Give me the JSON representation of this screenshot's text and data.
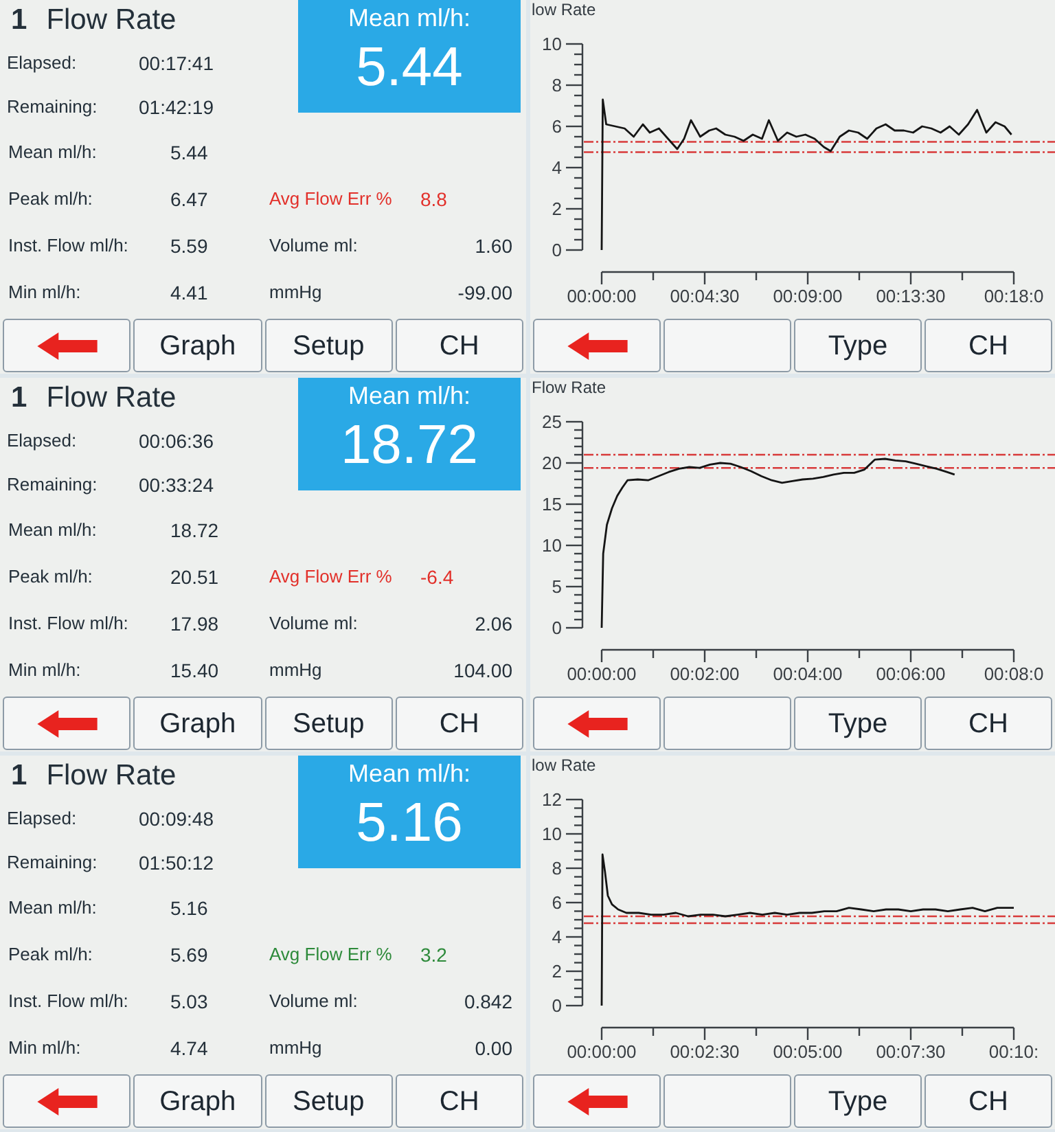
{
  "screens": [
    {
      "stats": {
        "channel": "1",
        "title": "Flow Rate",
        "mean_display": {
          "label": "Mean ml/h:",
          "value": "5.44"
        },
        "timers": [
          {
            "label": "Elapsed:",
            "value": "00:17:41"
          },
          {
            "label": "Remaining:",
            "value": "01:42:19"
          }
        ],
        "rates": [
          {
            "label": "Mean ml/h:",
            "value": "5.44"
          },
          {
            "label": "Peak ml/h:",
            "value": "6.47"
          },
          {
            "label": "Inst. Flow ml/h:",
            "value": "5.59"
          },
          {
            "label": "Min ml/h:",
            "value": "4.41"
          }
        ],
        "avg_flow_err": {
          "label": "Avg Flow Err %",
          "value": "8.8",
          "within_tolerance": false
        },
        "totals": [
          {
            "label": "Volume ml:",
            "value": "1.60"
          },
          {
            "label": "mmHg",
            "value": "-99.00"
          }
        ],
        "buttons": [
          {
            "kind": "back"
          },
          {
            "kind": "text",
            "label": "Graph"
          },
          {
            "kind": "text",
            "label": "Setup"
          },
          {
            "kind": "text",
            "label": "CH"
          }
        ]
      },
      "graph": {
        "chart_data": {
          "type": "line",
          "title": "low Rate",
          "x": [
            0,
            0.05,
            0.2,
            0.6,
            1.0,
            1.4,
            1.8,
            2.1,
            2.5,
            2.9,
            3.3,
            3.6,
            3.9,
            4.3,
            4.7,
            5.0,
            5.4,
            5.8,
            6.2,
            6.6,
            7.0,
            7.3,
            7.7,
            8.1,
            8.5,
            8.9,
            9.3,
            9.7,
            10.0,
            10.4,
            10.8,
            11.2,
            11.6,
            12.0,
            12.4,
            12.8,
            13.2,
            13.6,
            14.0,
            14.4,
            14.8,
            15.2,
            15.6,
            16.0,
            16.4,
            16.8,
            17.2,
            17.6,
            17.9
          ],
          "values": [
            0,
            7.3,
            6.1,
            6.0,
            5.9,
            5.5,
            6.1,
            5.7,
            5.9,
            5.4,
            4.9,
            5.4,
            6.3,
            5.5,
            5.8,
            5.9,
            5.6,
            5.5,
            5.3,
            5.6,
            5.4,
            6.3,
            5.3,
            5.7,
            5.5,
            5.6,
            5.4,
            5.0,
            4.8,
            5.5,
            5.8,
            5.7,
            5.4,
            5.9,
            6.1,
            5.8,
            5.8,
            5.7,
            6.0,
            5.9,
            5.7,
            6.0,
            5.6,
            6.1,
            6.8,
            5.7,
            6.2,
            6.0,
            5.6
          ],
          "xlim": [
            0,
            18
          ],
          "ylim": [
            0,
            10
          ],
          "xticks": [
            {
              "value": 0,
              "label": "00:00:00"
            },
            {
              "value": 4.5,
              "label": "00:04:30"
            },
            {
              "value": 9,
              "label": "00:09:00"
            },
            {
              "value": 13.5,
              "label": "00:13:30"
            },
            {
              "value": 18,
              "label": "00:18:0"
            }
          ],
          "yticks": [
            0,
            2,
            4,
            6,
            8,
            10
          ],
          "ref_lines": [
            {
              "axis": "y",
              "value": 5.25
            },
            {
              "axis": "y",
              "value": 4.75
            }
          ]
        },
        "buttons": [
          {
            "kind": "back"
          },
          {
            "kind": "blank"
          },
          {
            "kind": "text",
            "label": "Type"
          },
          {
            "kind": "text",
            "label": "CH"
          }
        ]
      }
    },
    {
      "stats": {
        "channel": "1",
        "title": "Flow Rate",
        "mean_display": {
          "label": "Mean ml/h:",
          "value": "18.72"
        },
        "timers": [
          {
            "label": "Elapsed:",
            "value": "00:06:36"
          },
          {
            "label": "Remaining:",
            "value": "00:33:24"
          }
        ],
        "rates": [
          {
            "label": "Mean ml/h:",
            "value": "18.72"
          },
          {
            "label": "Peak ml/h:",
            "value": "20.51"
          },
          {
            "label": "Inst. Flow ml/h:",
            "value": "17.98"
          },
          {
            "label": "Min ml/h:",
            "value": "15.40"
          }
        ],
        "avg_flow_err": {
          "label": "Avg Flow Err %",
          "value": "-6.4",
          "within_tolerance": false
        },
        "totals": [
          {
            "label": "Volume ml:",
            "value": "2.06"
          },
          {
            "label": "mmHg",
            "value": "104.00"
          }
        ],
        "buttons": [
          {
            "kind": "back"
          },
          {
            "kind": "text",
            "label": "Graph"
          },
          {
            "kind": "text",
            "label": "Setup"
          },
          {
            "kind": "text",
            "label": "CH"
          }
        ]
      },
      "graph": {
        "chart_data": {
          "type": "line",
          "title": "Flow Rate",
          "x": [
            0,
            0.03,
            0.1,
            0.2,
            0.3,
            0.4,
            0.5,
            0.7,
            0.9,
            1.1,
            1.3,
            1.5,
            1.7,
            1.9,
            2.1,
            2.3,
            2.5,
            2.7,
            2.9,
            3.1,
            3.3,
            3.5,
            3.7,
            3.9,
            4.1,
            4.3,
            4.5,
            4.7,
            4.9,
            5.1,
            5.3,
            5.5,
            5.7,
            5.9,
            6.1,
            6.3,
            6.5,
            6.7,
            6.85
          ],
          "values": [
            0,
            9,
            12.5,
            14.5,
            16,
            17,
            17.9,
            18.0,
            17.9,
            18.4,
            18.9,
            19.3,
            19.5,
            19.4,
            19.8,
            20.0,
            19.9,
            19.5,
            19.0,
            18.4,
            17.9,
            17.6,
            17.8,
            18.0,
            18.1,
            18.3,
            18.6,
            18.8,
            18.8,
            19.2,
            20.4,
            20.5,
            20.3,
            20.2,
            19.9,
            19.6,
            19.3,
            18.9,
            18.6
          ],
          "xlim": [
            0,
            8
          ],
          "ylim": [
            0,
            25
          ],
          "xticks": [
            {
              "value": 0,
              "label": "00:00:00"
            },
            {
              "value": 2,
              "label": "00:02:00"
            },
            {
              "value": 4,
              "label": "00:04:00"
            },
            {
              "value": 6,
              "label": "00:06:00"
            },
            {
              "value": 8,
              "label": "00:08:0"
            }
          ],
          "yticks": [
            0,
            5,
            10,
            15,
            20,
            25
          ],
          "ref_lines": [
            {
              "axis": "y",
              "value": 21
            },
            {
              "axis": "y",
              "value": 19.4
            }
          ]
        },
        "buttons": [
          {
            "kind": "back"
          },
          {
            "kind": "blank"
          },
          {
            "kind": "text",
            "label": "Type"
          },
          {
            "kind": "text",
            "label": "CH"
          }
        ]
      }
    },
    {
      "stats": {
        "channel": "1",
        "title": "Flow Rate",
        "mean_display": {
          "label": "Mean ml/h:",
          "value": "5.16"
        },
        "timers": [
          {
            "label": "Elapsed:",
            "value": "00:09:48"
          },
          {
            "label": "Remaining:",
            "value": "01:50:12"
          }
        ],
        "rates": [
          {
            "label": "Mean ml/h:",
            "value": "5.16"
          },
          {
            "label": "Peak ml/h:",
            "value": "5.69"
          },
          {
            "label": "Inst. Flow ml/h:",
            "value": "5.03"
          },
          {
            "label": "Min ml/h:",
            "value": "4.74"
          }
        ],
        "avg_flow_err": {
          "label": "Avg Flow Err %",
          "value": "3.2",
          "within_tolerance": true
        },
        "totals": [
          {
            "label": "Volume ml:",
            "value": "0.842"
          },
          {
            "label": "mmHg",
            "value": "0.00"
          }
        ],
        "buttons": [
          {
            "kind": "back"
          },
          {
            "kind": "text",
            "label": "Graph"
          },
          {
            "kind": "text",
            "label": "Setup"
          },
          {
            "kind": "text",
            "label": "CH"
          }
        ]
      },
      "graph": {
        "chart_data": {
          "type": "line",
          "title": "low Rate",
          "x": [
            0,
            0.02,
            0.08,
            0.15,
            0.25,
            0.4,
            0.6,
            0.9,
            1.2,
            1.5,
            1.8,
            2.1,
            2.4,
            2.7,
            3.0,
            3.3,
            3.6,
            3.9,
            4.2,
            4.5,
            4.8,
            5.1,
            5.4,
            5.7,
            6.0,
            6.3,
            6.6,
            6.9,
            7.2,
            7.5,
            7.8,
            8.1,
            8.4,
            8.7,
            9.0,
            9.3,
            9.6,
            10.0
          ],
          "values": [
            0,
            8.8,
            7.8,
            6.4,
            5.9,
            5.6,
            5.4,
            5.4,
            5.3,
            5.3,
            5.4,
            5.2,
            5.3,
            5.3,
            5.2,
            5.3,
            5.4,
            5.3,
            5.4,
            5.3,
            5.4,
            5.4,
            5.5,
            5.5,
            5.7,
            5.6,
            5.5,
            5.6,
            5.6,
            5.5,
            5.6,
            5.6,
            5.5,
            5.6,
            5.7,
            5.5,
            5.7,
            5.7
          ],
          "xlim": [
            0,
            10
          ],
          "ylim": [
            0,
            12
          ],
          "xticks": [
            {
              "value": 0,
              "label": "00:00:00"
            },
            {
              "value": 2.5,
              "label": "00:02:30"
            },
            {
              "value": 5,
              "label": "00:05:00"
            },
            {
              "value": 7.5,
              "label": "00:07:30"
            },
            {
              "value": 10,
              "label": "00:10:"
            }
          ],
          "yticks": [
            0,
            2,
            4,
            6,
            8,
            10,
            12
          ],
          "ref_lines": [
            {
              "axis": "y",
              "value": 5.2
            },
            {
              "axis": "y",
              "value": 4.8
            }
          ]
        },
        "buttons": [
          {
            "kind": "back"
          },
          {
            "kind": "blank"
          },
          {
            "kind": "text",
            "label": "Type"
          },
          {
            "kind": "text",
            "label": "CH"
          }
        ]
      }
    }
  ]
}
